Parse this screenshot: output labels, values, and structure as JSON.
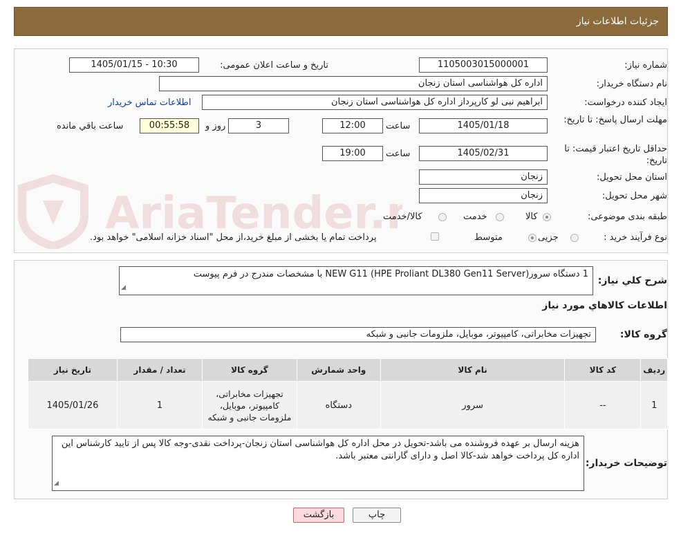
{
  "header": {
    "title": "جزئیات اطلاعات نیاز"
  },
  "form": {
    "need_number_label": "شماره نیاز:",
    "need_number": "1105003015000001",
    "announce_label": "تاریخ و ساعت اعلان عمومی:",
    "announce_value": "1405/01/15 - 10:30",
    "buyer_org_label": "نام دستگاه خریدار:",
    "buyer_org": "اداره کل هواشناسی استان زنجان",
    "creator_label": "ایجاد کننده درخواست:",
    "creator": "ابراهیم نبی لو کارپرداز اداره کل هواشناسی استان زنجان",
    "contact_link": "اطلاعات تماس خریدار",
    "deadline_label": "مهلت ارسال پاسخ: تا تاریخ:",
    "deadline_date": "1405/01/18",
    "time_label": "ساعت",
    "deadline_time": "12:00",
    "days_value": "3",
    "days_label": "روز و",
    "remaining_time": "00:55:58",
    "remaining_label": "ساعت باقي مانده",
    "validity_label": "حداقل تاریخ اعتبار قیمت: تا تاریخ:",
    "validity_date": "1405/02/31",
    "validity_time": "19:00",
    "province_label": "استان محل تحویل:",
    "province": "زنجان",
    "city_label": "شهر محل تحویل:",
    "city": "زنجان",
    "category_label": "طبقه بندی موضوعی:",
    "category_options": [
      "کالا",
      "خدمت",
      "کالا/خدمت"
    ],
    "process_label": "نوع فرآیند خرید :",
    "process_options": [
      "جزیی",
      "متوسط"
    ],
    "payment_note": "پرداخت تمام یا بخشی از مبلغ خرید،از محل \"اسناد خزانه اسلامی\" خواهد بود."
  },
  "need": {
    "summary_label": "شرح کلي نیاز:",
    "summary": "1 دستگاه  سرور(HPE Proliant DL380 Gen11 Server)  NEW G11  با مشخصات مندرج در فرم پیوست",
    "goods_info_title": "اطلاعات کالاهاي مورد نیاز",
    "goods_group_label": "گروه کالا:",
    "goods_group": "تجهیزات مخابراتی، کامپیوتر، موبایل، ملزومات جانبی و شبکه"
  },
  "table": {
    "headers": [
      "ردیف",
      "کد کالا",
      "نام کالا",
      "واحد شمارش",
      "گروه کالا",
      "تعداد / مقدار",
      "تاریخ نیاز"
    ],
    "rows": [
      [
        "1",
        "--",
        "سرور",
        "دستگاه",
        "تجهیزات مخابراتی، کامپیوتر، موبایل، ملزومات جانبی و شبکه",
        "1",
        "1405/01/26"
      ]
    ]
  },
  "buyer_notes": {
    "label": "توضیحات خریدار:",
    "text": "هزینه ارسال بر عهده فروشنده می باشد-تحویل در محل اداره کل هواشناسی استان زنجان-پرداخت نقدی-وجه کالا پس از تایید کارشناس این اداره کل پرداخت خواهد شد-کالا اصل و دارای گارانتی معتبر باشد."
  },
  "buttons": {
    "print": "چاپ",
    "back": "بازگشت"
  },
  "watermark": {
    "text": "AriaTender.neT"
  },
  "colors": {
    "header_bg": "#8b6a3b",
    "timer_bg": "#ffffd9",
    "link": "#0b3ea8",
    "watermark": "#b02020"
  }
}
